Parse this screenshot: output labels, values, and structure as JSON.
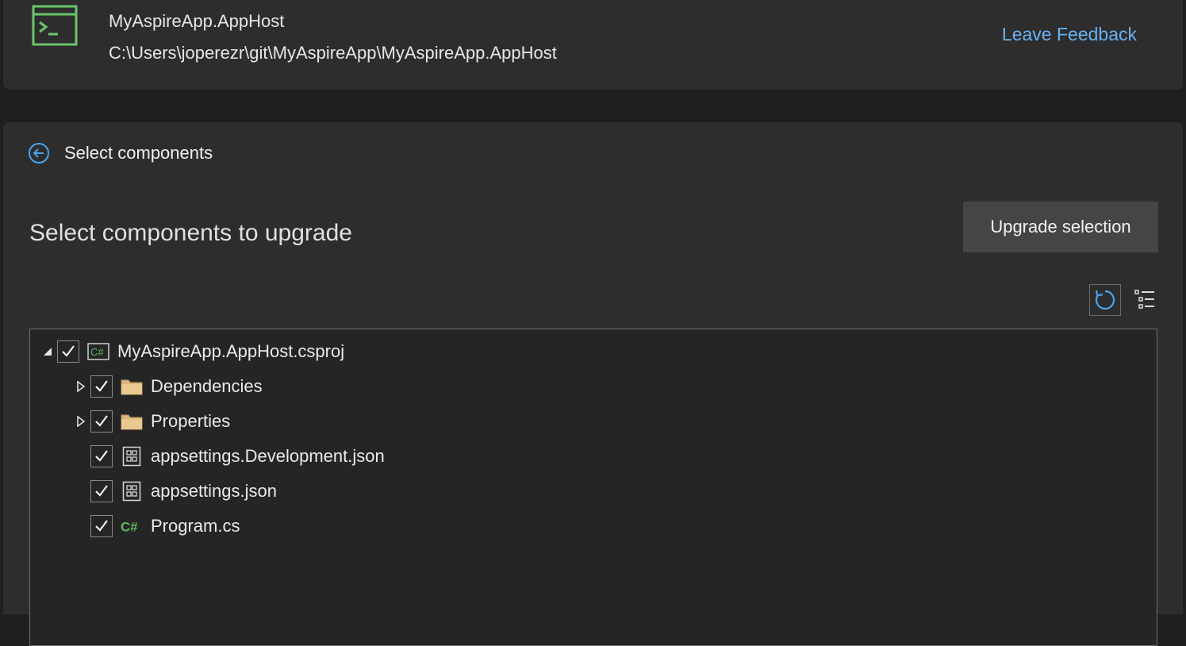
{
  "header": {
    "project_name": "MyAspireApp.AppHost",
    "project_path": "C:\\Users\\joperezr\\git\\MyAspireApp\\MyAspireApp.AppHost",
    "feedback_link": "Leave Feedback",
    "app_icon": "console-app-icon"
  },
  "step": {
    "back_icon": "back-arrow-icon",
    "title": "Select components"
  },
  "main": {
    "heading": "Select components to upgrade",
    "upgrade_button": "Upgrade selection",
    "refresh_icon": "refresh-icon",
    "filter_icon": "list-filter-icon"
  },
  "tree": {
    "items": [
      {
        "label": "MyAspireApp.AppHost.csproj",
        "icon": "csharp-project-icon",
        "checked": true,
        "expander": "expanded"
      },
      {
        "label": "Dependencies",
        "icon": "folder-icon",
        "checked": true,
        "expander": "collapsed"
      },
      {
        "label": "Properties",
        "icon": "folder-icon",
        "checked": true,
        "expander": "collapsed"
      },
      {
        "label": "appsettings.Development.json",
        "icon": "json-settings-icon",
        "checked": true,
        "expander": "none"
      },
      {
        "label": "appsettings.json",
        "icon": "json-settings-icon",
        "checked": true,
        "expander": "none"
      },
      {
        "label": "Program.cs",
        "icon": "csharp-file-icon",
        "checked": true,
        "expander": "none"
      }
    ]
  },
  "colors": {
    "accent_link": "#6ab0f3",
    "icon_green": "#5fb85f",
    "folder_fill": "#dcb67a"
  }
}
